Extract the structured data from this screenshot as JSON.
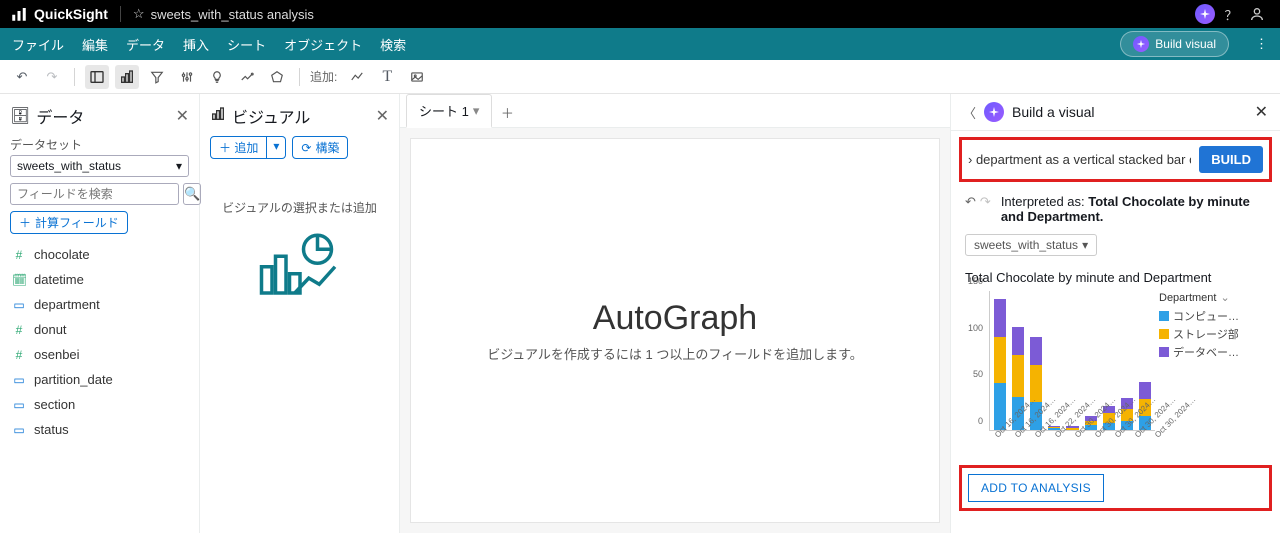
{
  "app": {
    "name": "QuickSight",
    "doc_title": "sweets_with_status analysis"
  },
  "menu": {
    "items": [
      "ファイル",
      "編集",
      "データ",
      "挿入",
      "シート",
      "オブジェクト",
      "検索"
    ],
    "build_visual": "Build visual"
  },
  "toolbar": {
    "add_label": "追加:"
  },
  "data_panel": {
    "title": "データ",
    "dataset_label": "データセット",
    "dataset_value": "sweets_with_status",
    "search_placeholder": "フィールドを検索",
    "calc_field_btn": "計算フィールド",
    "fields": [
      {
        "name": "chocolate",
        "type": "num"
      },
      {
        "name": "datetime",
        "type": "dat"
      },
      {
        "name": "department",
        "type": "str"
      },
      {
        "name": "donut",
        "type": "num"
      },
      {
        "name": "osenbei",
        "type": "num"
      },
      {
        "name": "partition_date",
        "type": "str"
      },
      {
        "name": "section",
        "type": "str"
      },
      {
        "name": "status",
        "type": "str"
      }
    ]
  },
  "visual_panel": {
    "title": "ビジュアル",
    "add_btn": "追加",
    "structure_btn": "構築",
    "placeholder": "ビジュアルの選択または追加"
  },
  "sheet": {
    "tab_label": "シート 1",
    "autograph_title": "AutoGraph",
    "autograph_desc": "ビジュアルを作成するには 1 つ以上のフィールドを追加します。"
  },
  "build": {
    "panel_title": "Build a visual",
    "prompt_text": "› department as a vertical stacked bar chart.",
    "build_btn": "BUILD",
    "interpreted_label": "Interpreted as:",
    "interpreted_value": "Total Chocolate by minute and Department.",
    "dataset_chip": "sweets_with_status",
    "chart_title": "Total Chocolate by minute and Department",
    "legend_title": "Department",
    "legend_items": [
      "コンピュー…",
      "ストレージ部",
      "データベー…"
    ],
    "add_to_analysis": "ADD TO ANALYSIS"
  },
  "chart_data": {
    "type": "bar",
    "stacked": true,
    "ylim": [
      0,
      150
    ],
    "yticks": [
      0,
      50,
      100,
      150
    ],
    "categories": [
      "Oct 16, 2024…",
      "Oct 16, 2024…",
      "Oct 16, 2024…",
      "Oct 22, 2024…",
      "Oct 30, 2024…",
      "Oct 30, 2024…",
      "Oct 30, 2024…",
      "Oct 30, 2024…",
      "Oct 30, 2024…"
    ],
    "series": [
      {
        "name": "コンピュー…",
        "color": "#2ea0e6",
        "values": [
          50,
          35,
          30,
          2,
          0,
          5,
          8,
          10,
          15
        ]
      },
      {
        "name": "ストレージ部",
        "color": "#f5b301",
        "values": [
          50,
          45,
          40,
          1,
          2,
          5,
          10,
          12,
          18
        ]
      },
      {
        "name": "データベー…",
        "color": "#7c5bd6",
        "values": [
          40,
          30,
          30,
          1,
          2,
          5,
          8,
          12,
          18
        ]
      }
    ],
    "title": "Total Chocolate by minute and Department",
    "xlabel": "",
    "ylabel": ""
  }
}
